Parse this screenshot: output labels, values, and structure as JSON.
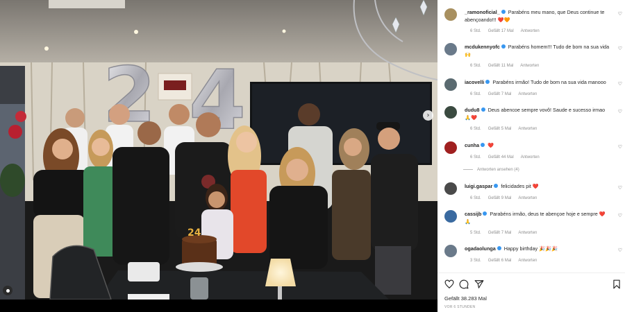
{
  "post": {
    "image_alt": "group birthday photo",
    "likes_text": "Gefällt 38.283 Mal",
    "posted_text": "VOR 6 STUNDEN",
    "balloon_text": "24"
  },
  "actions": {
    "like_icon": "heart-outline",
    "comment_icon": "comment-bubble",
    "share_icon": "paper-plane",
    "save_icon": "bookmark"
  },
  "comments": [
    {
      "user": "_ramonoficial_",
      "text": "Parabéns meu mano, que Deus continue te abençoando!!! ❤️🧡",
      "time": "6 Std.",
      "likes": "Gefällt 17 Mal",
      "reply": "Antworten",
      "avatar_color": "#a89060"
    },
    {
      "user": "mcdukennyofc",
      "text": "Parabéns homem!!! Tudo de bom na sua vida 🙌",
      "time": "6 Std.",
      "likes": "Gefällt 11 Mal",
      "reply": "Antworten",
      "avatar_color": "#6a7a8a"
    },
    {
      "user": "iacovelli",
      "text": "Parabéns irmão! Tudo de bom na sua vida manooo",
      "time": "6 Std.",
      "likes": "Gefällt 7 Mal",
      "reply": "Antworten",
      "avatar_color": "#5a6a70"
    },
    {
      "user": "dudu8",
      "text": "Deus abencoe sempre vovô! Saude e sucesso irmao 🙏❤️",
      "time": "6 Std.",
      "likes": "Gefällt 5 Mal",
      "reply": "Antworten",
      "avatar_color": "#3a4a40"
    },
    {
      "user": "cunha",
      "text": "❤️",
      "time": "6 Std.",
      "likes": "Gefällt 44 Mal",
      "reply": "Antworten",
      "view_replies": "Antworten ansehen (4)",
      "avatar_color": "#a02020"
    },
    {
      "user": "luigi.gaspar",
      "text": "felicidades pit ❤️",
      "time": "6 Std.",
      "likes": "Gefällt 9 Mal",
      "reply": "Antworten",
      "avatar_color": "#4a4a4a"
    },
    {
      "user": "cassijb",
      "text": "Parabéns irmão, deus te abençoe hoje e sempre ❤️🙏",
      "time": "5 Std.",
      "likes": "Gefällt 7 Mal",
      "reply": "Antworten",
      "avatar_color": "#3a6aa0"
    },
    {
      "user": "ogadaolunga",
      "text": "Happy birthday 🎉🎉🎉",
      "time": "3 Std.",
      "likes": "Gefällt 6 Mal",
      "reply": "Antworten",
      "avatar_color": "#6a7a8a"
    }
  ]
}
